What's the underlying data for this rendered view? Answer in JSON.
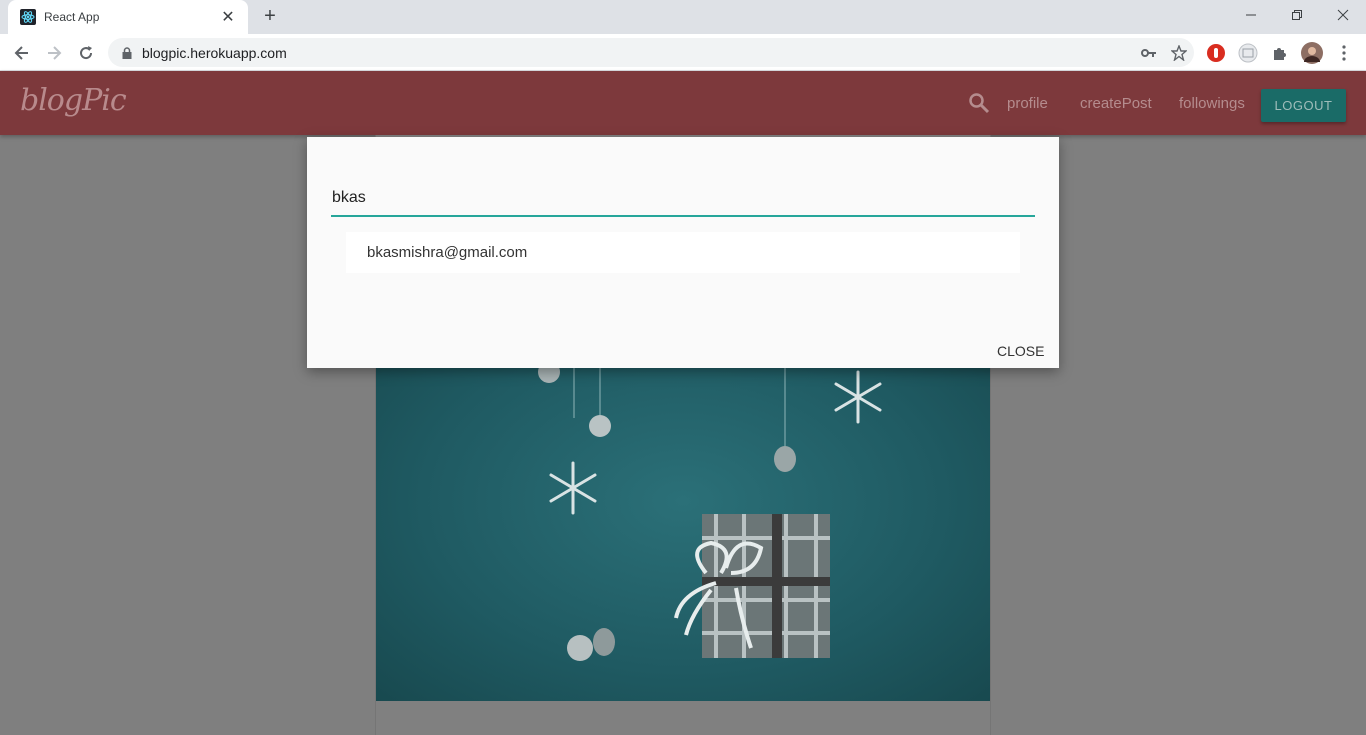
{
  "browser": {
    "tab_title": "React App",
    "url": "blogpic.herokuapp.com"
  },
  "app": {
    "brand": "blogPic",
    "nav": {
      "profile": "profile",
      "create_post": "createPost",
      "followings": "followings",
      "logout": "LOGOUT"
    }
  },
  "search_modal": {
    "query": "bkas",
    "results": [
      "bkasmishra@gmail.com"
    ],
    "close_label": "CLOSE"
  },
  "colors": {
    "appbar": "#7d393c",
    "accent": "#26a69a",
    "logout_button": "#1a6b67"
  }
}
